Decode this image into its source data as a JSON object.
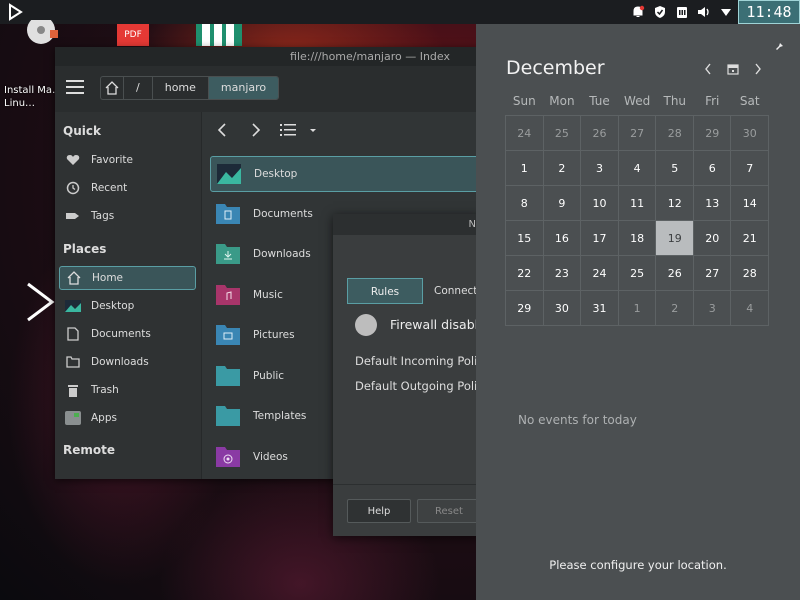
{
  "top_panel": {
    "clock": "11:48 PM",
    "tray_icons": [
      "notification-bell-icon",
      "shield-check-icon",
      "clipboard-icon",
      "volume-icon",
      "network-icon"
    ]
  },
  "desktop": {
    "install_label": "Install Ma… Linu…",
    "pdf_label": "PDF"
  },
  "file_manager": {
    "title": "file:///home/manjaro — Index",
    "breadcrumbs": [
      "/",
      "home",
      "manjaro"
    ],
    "sidebar": {
      "quick_label": "Quick",
      "quick_items": [
        {
          "label": "Favorite",
          "icon": "heart-icon"
        },
        {
          "label": "Recent",
          "icon": "history-icon"
        },
        {
          "label": "Tags",
          "icon": "tag-icon"
        }
      ],
      "places_label": "Places",
      "places_items": [
        {
          "label": "Home",
          "icon": "home-icon"
        },
        {
          "label": "Desktop",
          "icon": "desktop-icon"
        },
        {
          "label": "Documents",
          "icon": "document-icon"
        },
        {
          "label": "Downloads",
          "icon": "folder-icon"
        },
        {
          "label": "Trash",
          "icon": "trash-icon"
        },
        {
          "label": "Apps",
          "icon": "apps-icon"
        }
      ],
      "remote_label": "Remote"
    },
    "files": [
      {
        "label": "Desktop",
        "color": "#2a7f86"
      },
      {
        "label": "Documents",
        "color": "#3a86b4"
      },
      {
        "label": "Downloads",
        "color": "#3a9a88"
      },
      {
        "label": "Music",
        "color": "#a8356a"
      },
      {
        "label": "Pictures",
        "color": "#3a86b4"
      },
      {
        "label": "Public",
        "color": "#3a9aa4"
      },
      {
        "label": "Templates",
        "color": "#3a9aa4"
      },
      {
        "label": "Videos",
        "color": "#8a3aa4"
      }
    ]
  },
  "firewall": {
    "title": "N",
    "tab_rules": "Rules",
    "tab_connections": "Connecti",
    "status": "Firewall disabl",
    "incoming": "Default Incoming Polic",
    "outgoing": "Default Outgoing Polic",
    "help": "Help",
    "reset": "Reset"
  },
  "calendar": {
    "month": "December",
    "weekdays": [
      "Sun",
      "Mon",
      "Tue",
      "Wed",
      "Thu",
      "Fri",
      "Sat"
    ],
    "weeks": [
      [
        "24",
        "25",
        "26",
        "27",
        "28",
        "29",
        "30"
      ],
      [
        "1",
        "2",
        "3",
        "4",
        "5",
        "6",
        "7"
      ],
      [
        "8",
        "9",
        "10",
        "11",
        "12",
        "13",
        "14"
      ],
      [
        "15",
        "16",
        "17",
        "18",
        "19",
        "20",
        "21"
      ],
      [
        "22",
        "23",
        "24",
        "25",
        "26",
        "27",
        "28"
      ],
      [
        "29",
        "30",
        "31",
        "1",
        "2",
        "3",
        "4"
      ]
    ],
    "today": "19",
    "no_events": "No events for today",
    "location_msg": "Please configure your location."
  }
}
